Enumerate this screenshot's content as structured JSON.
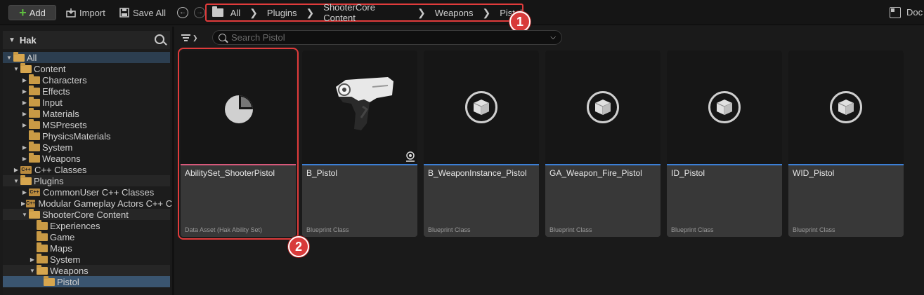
{
  "toolbar": {
    "add_label": "Add",
    "import_label": "Import",
    "save_all_label": "Save All",
    "docs_label": "Doc"
  },
  "breadcrumb": {
    "items": [
      "All",
      "Plugins",
      "ShooterCore Content",
      "Weapons",
      "Pistol"
    ]
  },
  "annotations": {
    "badge1": "1",
    "badge2": "2"
  },
  "sidebar": {
    "title": "Hak",
    "tree": [
      {
        "label": "All"
      },
      {
        "label": "Content"
      },
      {
        "label": "Characters"
      },
      {
        "label": "Effects"
      },
      {
        "label": "Input"
      },
      {
        "label": "Materials"
      },
      {
        "label": "MSPresets"
      },
      {
        "label": "PhysicsMaterials"
      },
      {
        "label": "System"
      },
      {
        "label": "Weapons"
      },
      {
        "label": "C++ Classes"
      },
      {
        "label": "Plugins"
      },
      {
        "label": "CommonUser C++ Classes"
      },
      {
        "label": "Modular Gameplay Actors C++ C"
      },
      {
        "label": "ShooterCore Content"
      },
      {
        "label": "Experiences"
      },
      {
        "label": "Game"
      },
      {
        "label": "Maps"
      },
      {
        "label": "System"
      },
      {
        "label": "Weapons"
      },
      {
        "label": "Pistol"
      }
    ]
  },
  "content": {
    "search_placeholder": "Search Pistol",
    "assets": [
      {
        "name": "AbilitySet_ShooterPistol",
        "type": "Data Asset (Hak Ability Set)"
      },
      {
        "name": "B_Pistol",
        "type": "Blueprint Class"
      },
      {
        "name": "B_WeaponInstance_Pistol",
        "type": "Blueprint Class"
      },
      {
        "name": "GA_Weapon_Fire_Pistol",
        "type": "Blueprint Class"
      },
      {
        "name": "ID_Pistol",
        "type": "Blueprint Class"
      },
      {
        "name": "WID_Pistol",
        "type": "Blueprint Class"
      }
    ]
  },
  "colors": {
    "accent_blue": "#3b7fd6",
    "data_asset_pink": "#d6587a",
    "annotation_red": "#e03b3b",
    "folder": "#c99a45"
  }
}
